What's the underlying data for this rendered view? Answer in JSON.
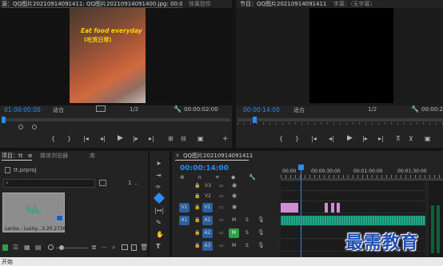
{
  "source_monitor": {
    "tab_label": "源：QQ图片20210914091411: QQ图片20210914091400.jpg: 00:00:06:13",
    "tab_effects": "效果控件",
    "image_text_line1": "Eat food everyday",
    "image_text_line2": "(吃货日常)",
    "timecode": "01:00:00:00",
    "fit": "适合",
    "ratio": "1/2",
    "duration": "00:00:02:00"
  },
  "program_monitor": {
    "tab_label": "节目：QQ图片20210914091411",
    "tab_captions": "字幕：（无字幕）",
    "timecode": "00:00:14:00",
    "fit": "适合",
    "ratio": "1/2",
    "duration": "00:00:25:00"
  },
  "project_panel": {
    "tab_project": "项目：tt",
    "tab_browser": "媒体浏览器",
    "tab_library": "库",
    "file_name": "tt.prproj",
    "count": "1",
    "clip_name": "Lenka - Lucky...",
    "clip_duration": "3:20 27360"
  },
  "timeline": {
    "tab_label": "QQ图片20210914091411",
    "timecode": "00:00:14:00",
    "ruler": [
      "00:00",
      "00:00:30:00",
      "00:01:00:00",
      "00:01:30:00"
    ],
    "video_tracks": [
      "V3",
      "V2",
      "V1"
    ],
    "audio_tracks": [
      "A1",
      "A2",
      "A3"
    ],
    "source_v": "V1",
    "source_a": "A1",
    "mute_label": "M",
    "solo_label": "S",
    "playhead_fraction": 0.18
  },
  "watermark": "最需教育",
  "start_button": "开始",
  "colors": {
    "accent": "#2d8ceb",
    "audio_clip": "#1fa787",
    "video_clip": "#d38bd3"
  }
}
